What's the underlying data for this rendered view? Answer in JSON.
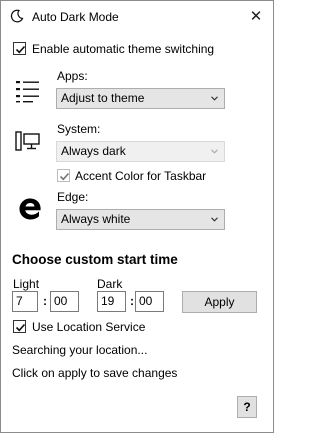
{
  "window": {
    "title": "Auto Dark Mode",
    "close_symbol": "✕"
  },
  "enable_switching": {
    "label": "Enable automatic theme switching",
    "checked": true
  },
  "apps": {
    "label": "Apps:",
    "value": "Adjust to theme"
  },
  "system": {
    "label": "System:",
    "value": "Always dark",
    "disabled": true
  },
  "accent": {
    "label": "Accent Color for Taskbar",
    "checked": true,
    "disabled": true
  },
  "edge": {
    "label": "Edge:",
    "value": "Always white"
  },
  "custom_time": {
    "heading": "Choose custom start time",
    "light_label": "Light",
    "dark_label": "Dark",
    "light_hour": "7",
    "light_minute": "00",
    "dark_hour": "19",
    "dark_minute": "00",
    "separator": ":",
    "apply_label": "Apply"
  },
  "location": {
    "label": "Use Location Service",
    "checked": true,
    "status": "Searching your location..."
  },
  "hint": "Click on apply to save changes",
  "help_label": "?",
  "icons": [
    "moon-icon",
    "list-icon",
    "computer-icon",
    "edge-icon",
    "check-icon",
    "chevron-down-icon"
  ]
}
